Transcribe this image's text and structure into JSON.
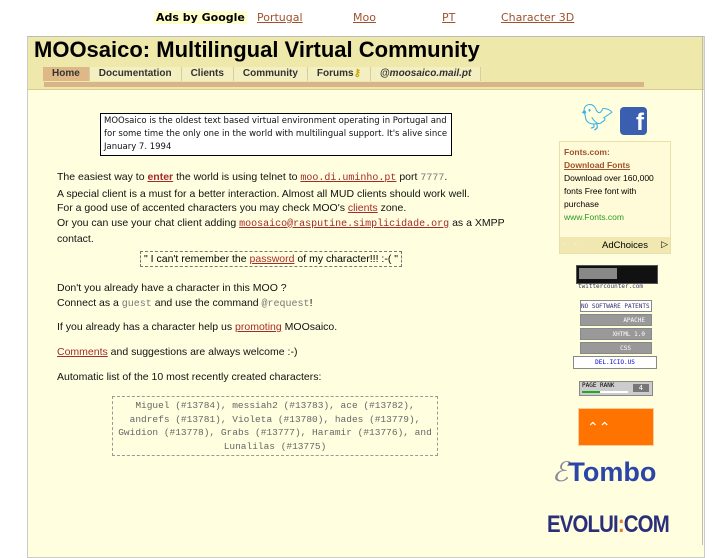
{
  "ads": {
    "label": "Ads by Google",
    "links": [
      "Portugal",
      "Moo",
      "PT",
      "Character 3D"
    ]
  },
  "header": {
    "title": "MOOsaico: Multilingual Virtual Community",
    "tabs": [
      "Home",
      "Documentation",
      "Clients",
      "Community",
      "Forums",
      "@moosaico.mail.pt"
    ]
  },
  "intro": "MOOsaico is the oldest text based virtual environment operating in Portugal and for some time the only one in the world with multilingual support. It's alive since January 7. 1994",
  "main": {
    "p1a": "The easiest way to ",
    "enter": "enter",
    "p1b": " the world is using telnet to ",
    "host": "moo.di.uminho.pt",
    "p1c": " port ",
    "port": "7777",
    "p1d": ".",
    "p2": "A special client is a must for a better interaction. Almost all MUD clients should work well.",
    "p3a": "For a good use of accented characters you may check MOO's ",
    "clients": "clients",
    "p3b": " zone.",
    "p4a": "Or you can use your chat client adding ",
    "xmpp": "moosaico@rasputine.simplicidade.org",
    "p4b": " as a XMPP contact.",
    "q1": "\" I can't remember the ",
    "password": "password",
    "q2": " of my character!!! :-( \"",
    "p5": "Don't you already have a character in this MOO ?",
    "p6a": "Connect as a ",
    "guest": "guest",
    "p6b": " and use the command ",
    "request": "@request",
    "p6c": "!",
    "p7a": "If you already has a character help us ",
    "promoting": "promoting",
    "p7b": " MOOsaico.",
    "comments": "Comments",
    "p8": " and suggestions are always welcome :-)",
    "p9": "Automatic list of the 10 most recently created characters:",
    "list": "Miguel (#13784), messiah2 (#13783), ace (#13782), andrefs (#13781), Violeta (#13780), hades (#13779), Gwidion (#13778), Grabs (#13777), Haramir (#13776), and Lunalilas (#13775)"
  },
  "sidebar": {
    "ad_title": "Fonts.com:",
    "ad_link": "Download Fonts",
    "ad_text": "Download over 160,000 fonts Free font with purchase",
    "ad_url": "www.Fonts.com",
    "adchoices": "AdChoices",
    "twittercounter": "twittercounter.com",
    "badges": [
      "NO SOFTWARE PATENTS",
      "APACHE",
      "XHTML 1.0",
      "CSS",
      "DEL.ICIO.US"
    ],
    "pagerank_label": "PAGE RANK",
    "pagerank": "4",
    "pagerank_fraction": 0.4,
    "etombo": "Tombo",
    "evolui": "EVOLUI",
    "evolui2": "COM"
  }
}
